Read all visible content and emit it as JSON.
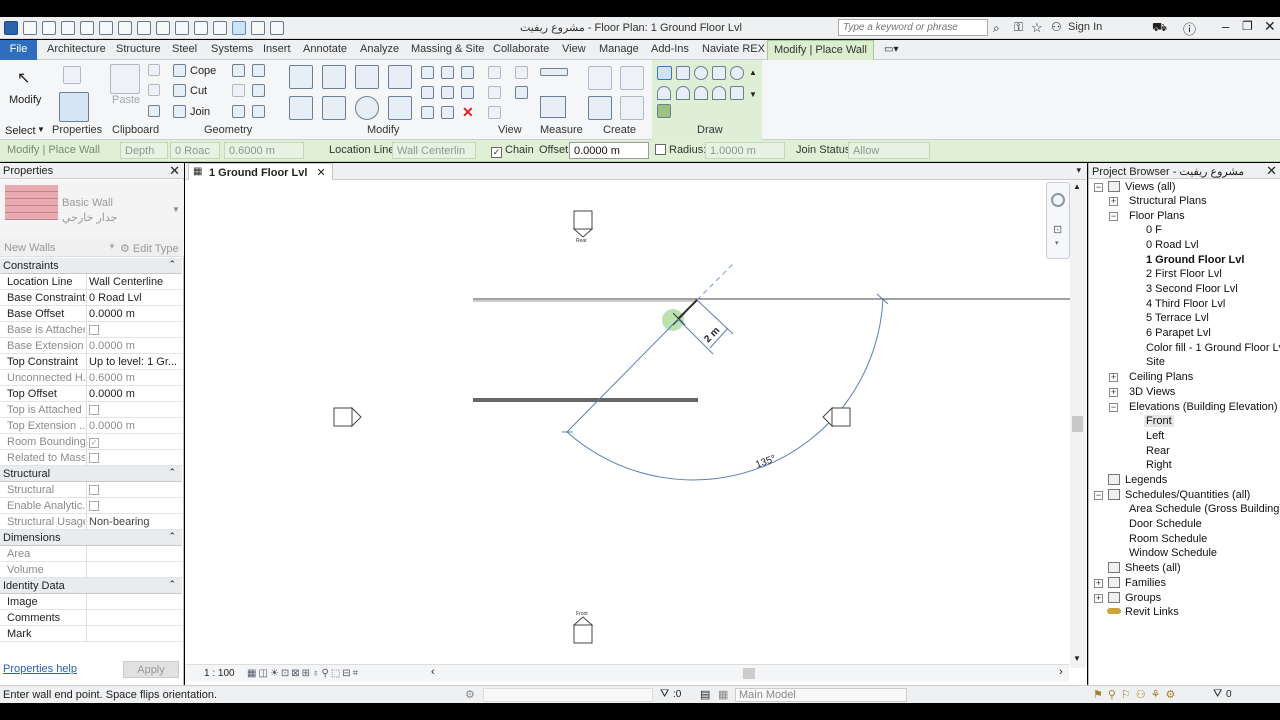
{
  "app": {
    "title": "مشروع ريفيت - Floor Plan: 1 Ground Floor Lvl",
    "search_placeholder": "Type a keyword or phrase",
    "sign_in": "Sign In",
    "accent_color": "#2f6ebc",
    "context_tab_color": "#dceecd"
  },
  "tabs": [
    "File",
    "Architecture",
    "Structure",
    "Steel",
    "Systems",
    "Insert",
    "Annotate",
    "Analyze",
    "Massing & Site",
    "Collaborate",
    "View",
    "Manage",
    "Add-Ins",
    "Naviate REX",
    "Modify | Place Wall"
  ],
  "ribbon": {
    "select_label": "Select",
    "modify_label": "Modify",
    "properties_label": "Properties",
    "paste_label": "Paste",
    "clipboard_label": "Clipboard",
    "cope_label": "Cope",
    "cut_label": "Cut",
    "join_label": "Join",
    "geometry_label": "Geometry",
    "modify_group_label": "Modify",
    "view_label": "View",
    "measure_label": "Measure",
    "create_label": "Create",
    "draw_label": "Draw"
  },
  "options_bar": {
    "context": "Modify | Place Wall",
    "depth_value": "Depth",
    "level_value": "0 Roac",
    "height_value": "0.6000 m",
    "location_line_label": "Location Line:",
    "location_line_value": "Wall Centerlin",
    "chain_label": "Chain",
    "offset_label": "Offset:",
    "offset_value": "0.0000 m",
    "radius_label": "Radius:",
    "radius_value": "1.0000 m",
    "join_status_label": "Join Status:",
    "join_status_value": "Allow"
  },
  "properties": {
    "title": "Properties",
    "type_family": "Basic Wall",
    "type_name": "جدار خارجي",
    "instance_selector": "New Walls",
    "edit_type": "Edit Type",
    "sections": {
      "constraints": "Constraints",
      "structural": "Structural",
      "dimensions": "Dimensions",
      "identity": "Identity Data"
    },
    "rows": {
      "location_line": {
        "k": "Location Line",
        "v": "Wall Centerline"
      },
      "base_constraint": {
        "k": "Base Constraint",
        "v": "0 Road Lvl"
      },
      "base_offset": {
        "k": "Base Offset",
        "v": "0.0000 m"
      },
      "base_attached": {
        "k": "Base is Attached",
        "v": ""
      },
      "base_extension": {
        "k": "Base Extension ...",
        "v": "0.0000 m"
      },
      "top_constraint": {
        "k": "Top Constraint",
        "v": "Up to level: 1 Gr..."
      },
      "unconnected": {
        "k": "Unconnected H...",
        "v": "0.6000 m"
      },
      "top_offset": {
        "k": "Top Offset",
        "v": "0.0000 m"
      },
      "top_attached": {
        "k": "Top is Attached",
        "v": ""
      },
      "top_extension": {
        "k": "Top Extension ...",
        "v": "0.0000 m"
      },
      "room_bounding": {
        "k": "Room Bounding",
        "v": ""
      },
      "related_mass": {
        "k": "Related to Mass",
        "v": ""
      },
      "structural": {
        "k": "Structural",
        "v": ""
      },
      "enable_analytic": {
        "k": "Enable Analytic...",
        "v": ""
      },
      "structural_usage": {
        "k": "Structural Usage",
        "v": "Non-bearing"
      },
      "area": {
        "k": "Area",
        "v": ""
      },
      "volume": {
        "k": "Volume",
        "v": ""
      },
      "image": {
        "k": "Image",
        "v": ""
      },
      "comments": {
        "k": "Comments",
        "v": ""
      },
      "mark": {
        "k": "Mark",
        "v": ""
      }
    },
    "help": "Properties help",
    "apply": "Apply"
  },
  "view": {
    "tab_label": "1 Ground Floor Lvl",
    "scale": "1 : 100",
    "dim_length": "2 m",
    "angle": "135°",
    "elev_rear": "Rear",
    "elev_front": "Front"
  },
  "browser": {
    "title": "Project Browser - مشروع ريفيت",
    "views_all": "Views (all)",
    "structural_plans": "Structural Plans",
    "floor_plans": "Floor Plans",
    "floor_items": [
      "0 F",
      "0 Road Lvl",
      "1 Ground Floor Lvl",
      "2 First Floor Lvl",
      "3 Second Floor Lvl",
      "4 Third Floor Lvl",
      "5 Terrace Lvl",
      "6 Parapet Lvl",
      "Color fill - 1 Ground Floor Lvl",
      "Site"
    ],
    "ceiling_plans": "Ceiling Plans",
    "views_3d": "3D Views",
    "elevations": "Elevations (Building Elevation)",
    "elevation_items": [
      "Front",
      "Left",
      "Rear",
      "Right"
    ],
    "legends": "Legends",
    "schedules": "Schedules/Quantities (all)",
    "schedule_items": [
      "Area Schedule (Gross Building)",
      "Door Schedule",
      "Room Schedule",
      "Window Schedule"
    ],
    "sheets": "Sheets (all)",
    "families": "Families",
    "groups": "Groups",
    "revit_links": "Revit Links"
  },
  "status": {
    "message": "Enter wall end point. Space flips orientation.",
    "workset_count": ":0",
    "model": "Main Model",
    "selection_count": "0"
  }
}
